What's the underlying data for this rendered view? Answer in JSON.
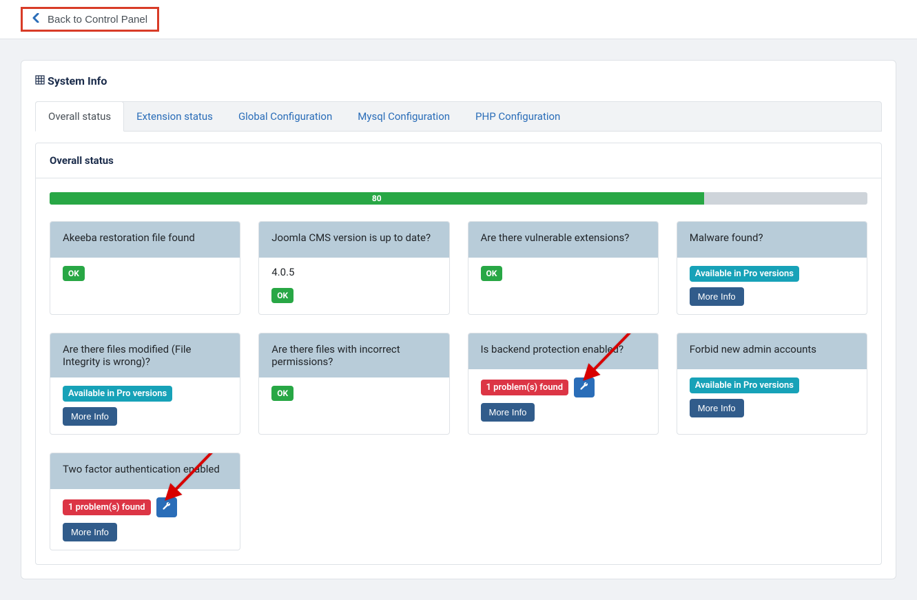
{
  "toolbar": {
    "back_label": "Back to Control Panel"
  },
  "panel_title": "System Info",
  "tabs": [
    {
      "label": "Overall status",
      "active": true
    },
    {
      "label": "Extension status",
      "active": false
    },
    {
      "label": "Global Configuration",
      "active": false
    },
    {
      "label": "Mysql Configuration",
      "active": false
    },
    {
      "label": "PHP Configuration",
      "active": false
    }
  ],
  "content_header": "Overall status",
  "progress": {
    "value": "80",
    "width_pct": "80%"
  },
  "labels": {
    "ok": "OK",
    "pro": "Available in Pro versions",
    "problem": "1 problem(s) found",
    "more": "More Info"
  },
  "cards": [
    {
      "title": "Akeeba restoration file found",
      "body_type": "ok"
    },
    {
      "title": "Joomla CMS version is up to date?",
      "body_type": "version_ok",
      "version": "4.0.5"
    },
    {
      "title": "Are there vulnerable extensions?",
      "body_type": "ok"
    },
    {
      "title": "Malware found?",
      "body_type": "pro_more"
    },
    {
      "title": "Are there files modified (File Integrity is wrong)?",
      "body_type": "pro_more"
    },
    {
      "title": "Are there files with incorrect permissions?",
      "body_type": "ok"
    },
    {
      "title": "Is backend protection enabled?",
      "body_type": "problem_fix_more",
      "arrow": true
    },
    {
      "title": "Forbid new admin accounts",
      "body_type": "pro_more"
    },
    {
      "title": "Two factor authentication enabled",
      "body_type": "problem_fix_more",
      "arrow": true
    }
  ]
}
